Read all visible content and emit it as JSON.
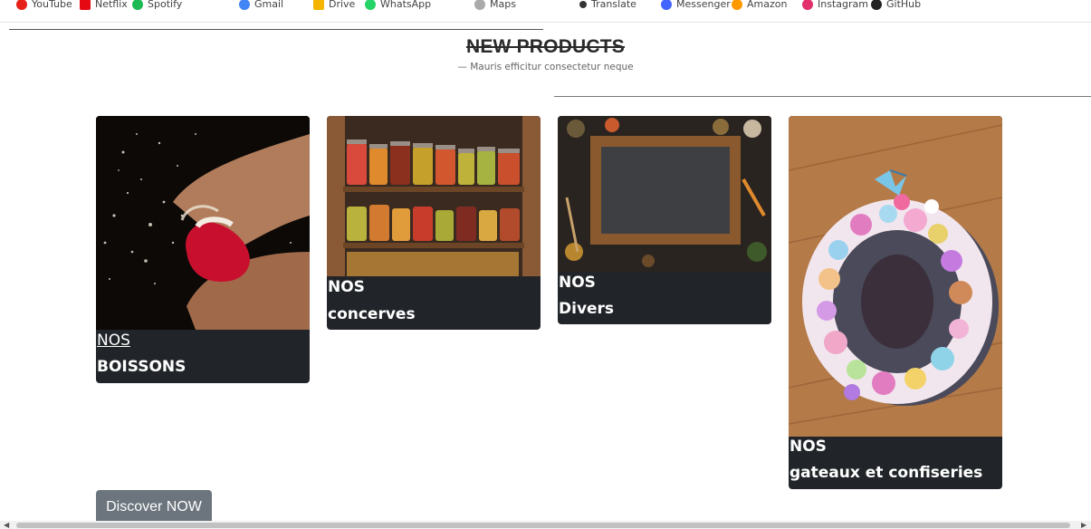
{
  "bookmarks": [
    {
      "label": "YouTube",
      "color": "#e62117"
    },
    {
      "label": "Netflix",
      "color": "#e50914"
    },
    {
      "label": "Spotify",
      "color": "#1db954"
    },
    {
      "label": "Gmail",
      "color": "#4285f4"
    },
    {
      "label": "Drive",
      "color": "#f4b400"
    },
    {
      "label": "WhatsApp",
      "color": "#25d366"
    },
    {
      "label": "Maps",
      "color": "#aaaaaa"
    },
    {
      "label": "Translate",
      "color": "#333333"
    },
    {
      "label": "Messenger",
      "color": "#4264ff"
    },
    {
      "label": "Amazon",
      "color": "#ff9900"
    },
    {
      "label": "Instagram",
      "color": "#e1306c"
    },
    {
      "label": "GitHub",
      "color": "#222222"
    }
  ],
  "section": {
    "title": "NEW PRODUCTS",
    "subtitle": "— Mauris efficitur consectetur neque"
  },
  "cards": [
    {
      "line1": "NOS",
      "line2": "BOISSONS"
    },
    {
      "line1": "NOS",
      "line2": "concerves"
    },
    {
      "line1": "NOS",
      "line2": "Divers"
    },
    {
      "line1": "NOS",
      "line2": "gateaux et confiseries"
    }
  ],
  "cta": {
    "label": "Discover NOW"
  },
  "colors": {
    "card_bg": "#212529",
    "button_bg": "#6c757d"
  }
}
